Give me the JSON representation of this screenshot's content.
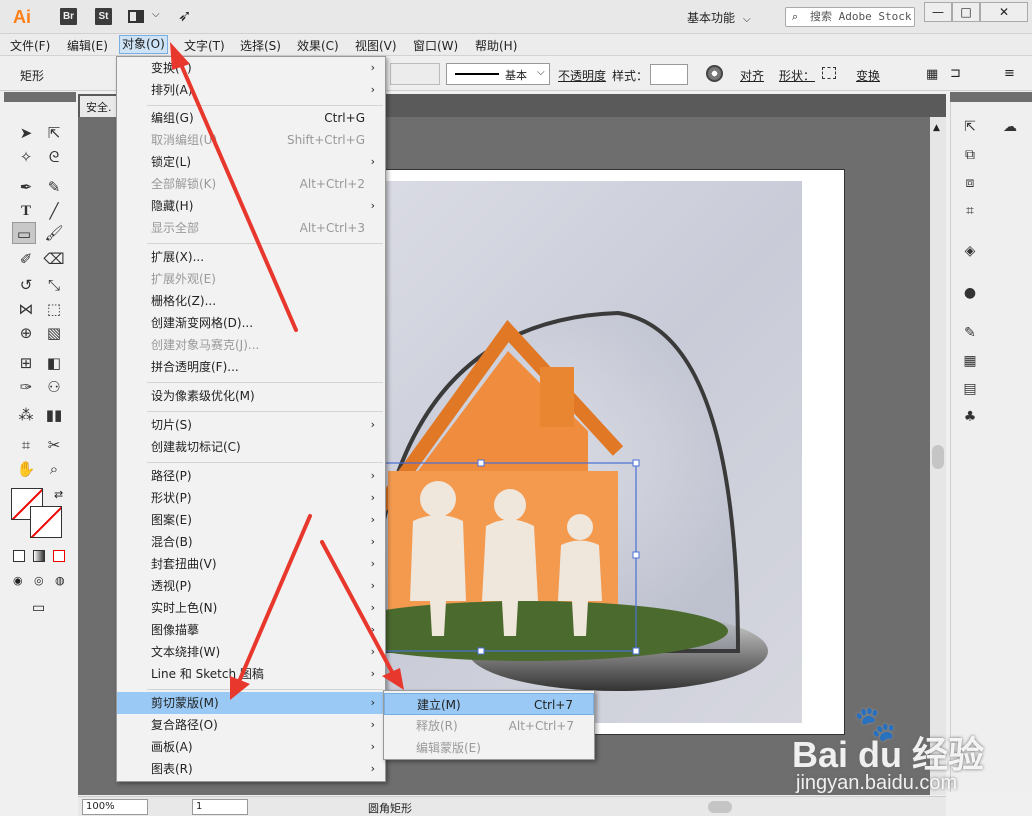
{
  "app": {
    "logo": "Ai",
    "bridge": "Br",
    "stock": "St",
    "workspace": "基本功能",
    "search_placeholder": "搜索 Adobe Stock",
    "minimize": "—",
    "maximize": "□",
    "close": "✕"
  },
  "menubar": [
    "文件(F)",
    "编辑(E)",
    "对象(O)",
    "文字(T)",
    "选择(S)",
    "效果(C)",
    "视图(V)",
    "窗口(W)",
    "帮助(H)"
  ],
  "controlbar": {
    "tool_label": "矩形",
    "stroke_style": "基本",
    "opacity_label": "不透明度",
    "style_label": "样式：",
    "align_label": "对齐",
    "shape_label": "形状：",
    "transform_label": "变换"
  },
  "document_tab": "安全.",
  "object_menu": [
    {
      "label": "变换(T)",
      "submenu": true
    },
    {
      "label": "排列(A)",
      "submenu": true
    },
    {
      "label": "编组(G)",
      "shortcut": "Ctrl+G"
    },
    {
      "label": "取消编组(U)",
      "shortcut": "Shift+Ctrl+G",
      "disabled": true
    },
    {
      "label": "锁定(L)",
      "submenu": true
    },
    {
      "label": "全部解锁(K)",
      "shortcut": "Alt+Ctrl+2",
      "disabled": true
    },
    {
      "label": "隐藏(H)",
      "submenu": true
    },
    {
      "label": "显示全部",
      "shortcut": "Alt+Ctrl+3",
      "disabled": true
    },
    {
      "label": "扩展(X)..."
    },
    {
      "label": "扩展外观(E)",
      "disabled": true
    },
    {
      "label": "栅格化(Z)..."
    },
    {
      "label": "创建渐变网格(D)..."
    },
    {
      "label": "创建对象马赛克(J)...",
      "disabled": true
    },
    {
      "label": "拼合透明度(F)..."
    },
    {
      "label": "设为像素级优化(M)"
    },
    {
      "label": "切片(S)",
      "submenu": true
    },
    {
      "label": "创建裁切标记(C)"
    },
    {
      "label": "路径(P)",
      "submenu": true
    },
    {
      "label": "形状(P)",
      "submenu": true
    },
    {
      "label": "图案(E)",
      "submenu": true
    },
    {
      "label": "混合(B)",
      "submenu": true
    },
    {
      "label": "封套扭曲(V)",
      "submenu": true
    },
    {
      "label": "透视(P)",
      "submenu": true
    },
    {
      "label": "实时上色(N)",
      "submenu": true
    },
    {
      "label": "图像描摹",
      "submenu": true
    },
    {
      "label": "文本绕排(W)",
      "submenu": true
    },
    {
      "label": "Line 和 Sketch 图稿",
      "submenu": true
    },
    {
      "label": "剪切蒙版(M)",
      "submenu": true,
      "highlighted": true
    },
    {
      "label": "复合路径(O)",
      "submenu": true
    },
    {
      "label": "画板(A)",
      "submenu": true
    },
    {
      "label": "图表(R)",
      "submenu": true
    }
  ],
  "clip_submenu": [
    {
      "label": "建立(M)",
      "shortcut": "Ctrl+7",
      "highlighted": true
    },
    {
      "label": "释放(R)",
      "shortcut": "Alt+Ctrl+7",
      "disabled": true
    },
    {
      "label": "编辑蒙版(E)",
      "disabled": true
    }
  ],
  "status": {
    "zoom": "100%",
    "page": "1",
    "tool_name": "圆角矩形"
  },
  "watermark": {
    "brand": "Bai du 经验",
    "url": "jingyan.baidu.com"
  },
  "colors": {
    "highlight": "#99c9f4",
    "canvas_gray": "#6e6e6e",
    "annotation_red": "#e8372c",
    "house_orange": "#f0883a",
    "selection_blue": "#4a6fd6"
  }
}
